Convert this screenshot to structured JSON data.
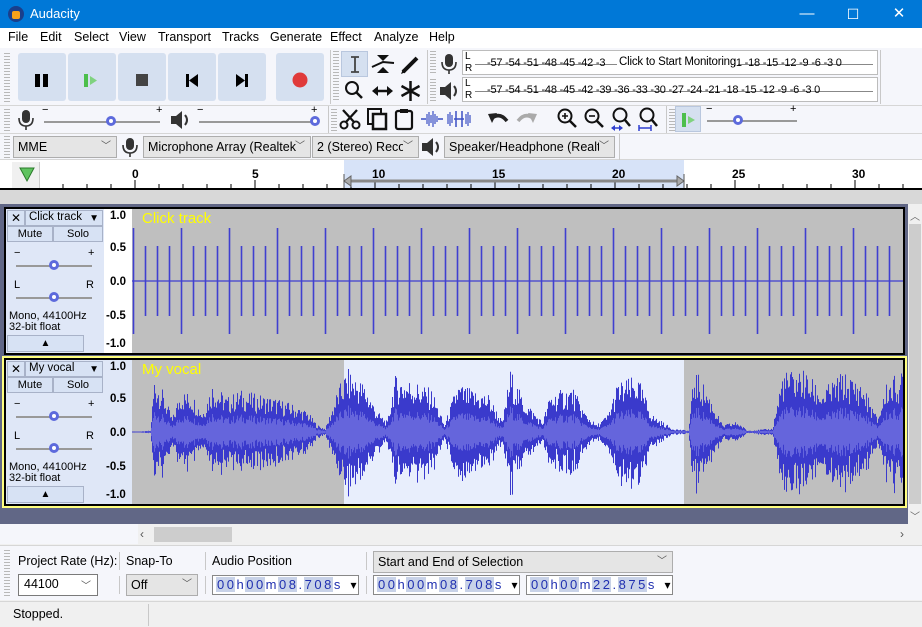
{
  "window": {
    "title": "Audacity",
    "minimize": "—",
    "maximize": "☐",
    "close": "✕"
  },
  "menu": [
    "File",
    "Edit",
    "Select",
    "View",
    "Transport",
    "Tracks",
    "Generate",
    "Effect",
    "Analyze",
    "Help"
  ],
  "transport": {
    "pause": "pause",
    "play": "play",
    "stop": "stop",
    "skip_start": "skip-to-start",
    "skip_end": "skip-to-end",
    "record": "record"
  },
  "tools": [
    "selection",
    "envelope",
    "draw",
    "zoom",
    "time-shift",
    "multi"
  ],
  "meters": {
    "record_scale": "-57 -54 -51 -48 -45 -42 -3",
    "record_scale_tail": ":1 -18 -15 -12  -9   -6   -3   0",
    "record_prompt": "Click to Start Monitoring",
    "playback_scale": "-57 -54 -51 -48 -45 -42 -39 -36 -33 -30 -27 -24 -21 -18 -15 -12  -9   -6   -3   0",
    "L": "L",
    "R": "R"
  },
  "mixer": {
    "record_volume": 0.58,
    "playback_volume": 1.0,
    "minus": "−",
    "plus": "+"
  },
  "playat_speed": {
    "value": 0.33,
    "minus": "−",
    "plus": "+"
  },
  "devices": {
    "host": "MME",
    "recording_device": "Microphone Array (Realtek",
    "channels": "2 (Stereo) Recor",
    "playback_device": "Speaker/Headphone (Realte"
  },
  "ruler": {
    "labels": [
      "0",
      "5",
      "10",
      "15",
      "20",
      "25",
      "30"
    ],
    "selection_start_s": 8.708,
    "selection_end_s": 22.875
  },
  "tracks": [
    {
      "name": "Click track",
      "label": "Click track",
      "mute": "Mute",
      "solo": "Solo",
      "gain": 0.5,
      "pan": 0.5,
      "gain_minus": "−",
      "gain_plus": "+",
      "pan_left": "L",
      "pan_right": "R",
      "info1": "Mono, 44100Hz",
      "info2": "32-bit float",
      "scale": [
        "1.0",
        "0.5",
        "0.0",
        "-0.5",
        "-1.0"
      ]
    },
    {
      "name": "My vocal",
      "label": "My vocal",
      "mute": "Mute",
      "solo": "Solo",
      "gain": 0.5,
      "pan": 0.5,
      "gain_minus": "−",
      "gain_plus": "+",
      "pan_left": "L",
      "pan_right": "R",
      "info1": "Mono, 44100Hz",
      "info2": "32-bit float",
      "scale": [
        "1.0",
        "0.5",
        "0.0",
        "-0.5",
        "-1.0"
      ]
    }
  ],
  "selection_toolbar": {
    "project_rate_label": "Project Rate (Hz):",
    "project_rate": "44100",
    "snap_label": "Snap-To",
    "snap": "Off",
    "audio_position_label": "Audio Position",
    "audio_position": "00h00m08.708s",
    "selection_mode": "Start and End of Selection",
    "selection_start": "00h00m08.708s",
    "selection_end": "00h00m22.875s"
  },
  "status": "Stopped.",
  "colors": {
    "titlebar": "#0078d7",
    "waveform": "#3f3fd0",
    "waveform_rms": "#6464dc",
    "track_label": "#ffff00",
    "selection": "#e8eefc",
    "record": "#e03a3a"
  }
}
